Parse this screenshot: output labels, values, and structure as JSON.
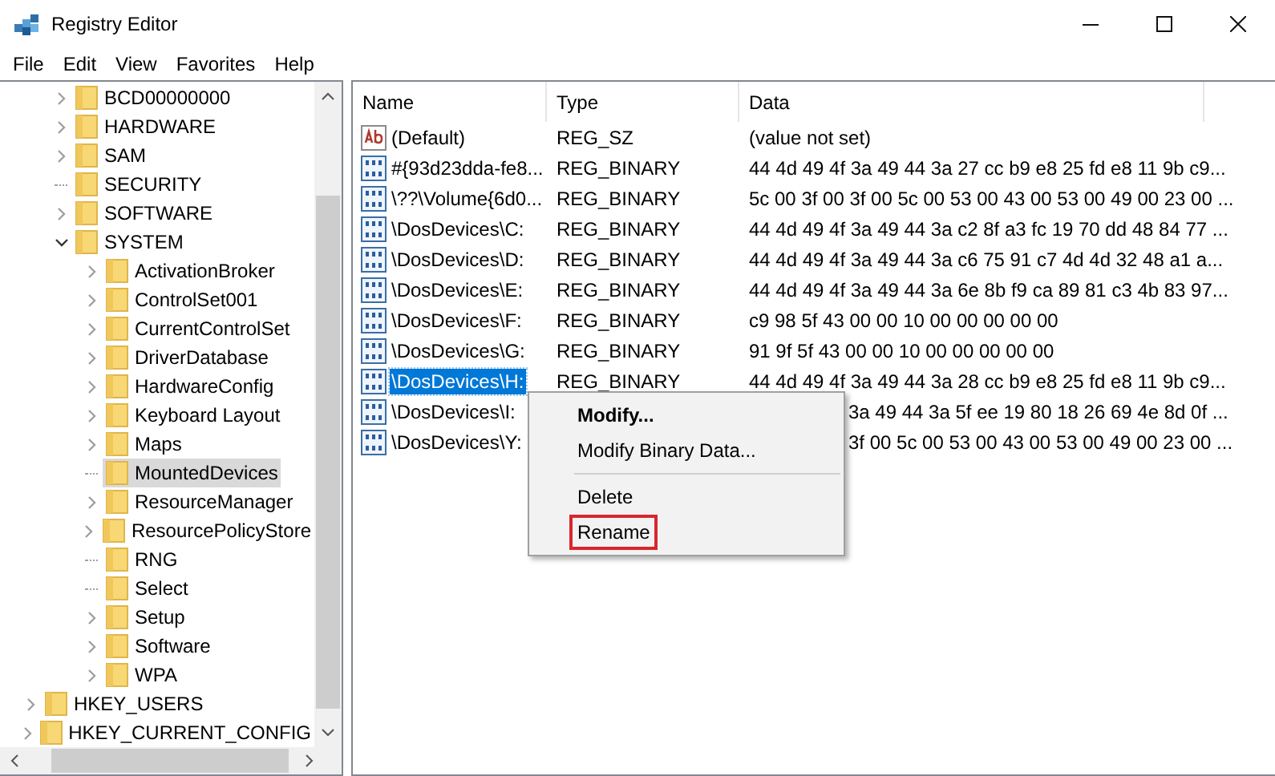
{
  "window": {
    "title": "Registry Editor"
  },
  "menu": [
    "File",
    "Edit",
    "View",
    "Favorites",
    "Help"
  ],
  "tree": {
    "machine_keys": [
      {
        "label": "BCD00000000",
        "kind": "collapsed",
        "selected": false
      },
      {
        "label": "HARDWARE",
        "kind": "collapsed",
        "selected": false
      },
      {
        "label": "SAM",
        "kind": "collapsed",
        "selected": false
      },
      {
        "label": "SECURITY",
        "kind": "leaf",
        "selected": false
      },
      {
        "label": "SOFTWARE",
        "kind": "collapsed",
        "selected": false
      },
      {
        "label": "SYSTEM",
        "kind": "expanded",
        "selected": false,
        "children": [
          {
            "label": "ActivationBroker",
            "kind": "collapsed",
            "selected": false
          },
          {
            "label": "ControlSet001",
            "kind": "collapsed",
            "selected": false
          },
          {
            "label": "CurrentControlSet",
            "kind": "collapsed",
            "selected": false
          },
          {
            "label": "DriverDatabase",
            "kind": "collapsed",
            "selected": false
          },
          {
            "label": "HardwareConfig",
            "kind": "collapsed",
            "selected": false
          },
          {
            "label": "Keyboard Layout",
            "kind": "collapsed",
            "selected": false
          },
          {
            "label": "Maps",
            "kind": "collapsed",
            "selected": false
          },
          {
            "label": "MountedDevices",
            "kind": "leaf",
            "selected": true
          },
          {
            "label": "ResourceManager",
            "kind": "collapsed",
            "selected": false
          },
          {
            "label": "ResourcePolicyStore",
            "kind": "collapsed",
            "selected": false
          },
          {
            "label": "RNG",
            "kind": "leaf",
            "selected": false
          },
          {
            "label": "Select",
            "kind": "leaf",
            "selected": false
          },
          {
            "label": "Setup",
            "kind": "collapsed",
            "selected": false
          },
          {
            "label": "Software",
            "kind": "collapsed",
            "selected": false
          },
          {
            "label": "WPA",
            "kind": "collapsed",
            "selected": false
          }
        ]
      }
    ],
    "root_keys": [
      {
        "label": "HKEY_USERS",
        "kind": "collapsed",
        "selected": false
      },
      {
        "label": "HKEY_CURRENT_CONFIG",
        "kind": "collapsed",
        "selected": false
      }
    ]
  },
  "table": {
    "columns": [
      "Name",
      "Type",
      "Data"
    ],
    "rows": [
      {
        "kind": "string",
        "name": "(Default)",
        "type": "REG_SZ",
        "data": "(value not set)",
        "selected": false
      },
      {
        "kind": "binary",
        "name": "#{93d23dda-fe8...",
        "type": "REG_BINARY",
        "data": "44 4d 49 4f 3a 49 44 3a 27 cc b9 e8 25 fd e8 11 9b c9...",
        "selected": false
      },
      {
        "kind": "binary",
        "name": "\\??\\Volume{6d0...",
        "type": "REG_BINARY",
        "data": "5c 00 3f 00 3f 00 5c 00 53 00 43 00 53 00 49 00 23 00 ...",
        "selected": false
      },
      {
        "kind": "binary",
        "name": "\\DosDevices\\C:",
        "type": "REG_BINARY",
        "data": "44 4d 49 4f 3a 49 44 3a c2 8f a3 fc 19 70 dd 48 84 77 ...",
        "selected": false
      },
      {
        "kind": "binary",
        "name": "\\DosDevices\\D:",
        "type": "REG_BINARY",
        "data": "44 4d 49 4f 3a 49 44 3a c6 75 91 c7 4d 4d 32 48 a1 a...",
        "selected": false
      },
      {
        "kind": "binary",
        "name": "\\DosDevices\\E:",
        "type": "REG_BINARY",
        "data": "44 4d 49 4f 3a 49 44 3a 6e 8b f9 ca 89 81 c3 4b 83 97...",
        "selected": false
      },
      {
        "kind": "binary",
        "name": "\\DosDevices\\F:",
        "type": "REG_BINARY",
        "data": "c9 98 5f 43 00 00 10 00 00 00 00 00",
        "selected": false
      },
      {
        "kind": "binary",
        "name": "\\DosDevices\\G:",
        "type": "REG_BINARY",
        "data": "91 9f 5f 43 00 00 10 00 00 00 00 00",
        "selected": false
      },
      {
        "kind": "binary",
        "name": "\\DosDevices\\H:",
        "type": "REG_BINARY",
        "data": "44 4d 49 4f 3a 49 44 3a 28 cc b9 e8 25 fd e8 11 9b c9...",
        "selected": true
      },
      {
        "kind": "binary",
        "name": "\\DosDevices\\I:",
        "type": "",
        "data": "3a 49 44 3a 5f ee 19 80 18 26 69 4e 8d 0f ...",
        "selected": false
      },
      {
        "kind": "binary",
        "name": "\\DosDevices\\Y:",
        "type": "",
        "data": "3f 00 5c 00 53 00 43 00 53 00 49 00 23 00 ...",
        "selected": false
      }
    ]
  },
  "context_menu": [
    {
      "kind": "item",
      "label": "Modify...",
      "default": true,
      "highlighted": false
    },
    {
      "kind": "item",
      "label": "Modify Binary Data...",
      "default": false,
      "highlighted": false
    },
    {
      "kind": "separator"
    },
    {
      "kind": "item",
      "label": "Delete",
      "default": false,
      "highlighted": false
    },
    {
      "kind": "item",
      "label": "Rename",
      "default": false,
      "highlighted": true
    }
  ]
}
